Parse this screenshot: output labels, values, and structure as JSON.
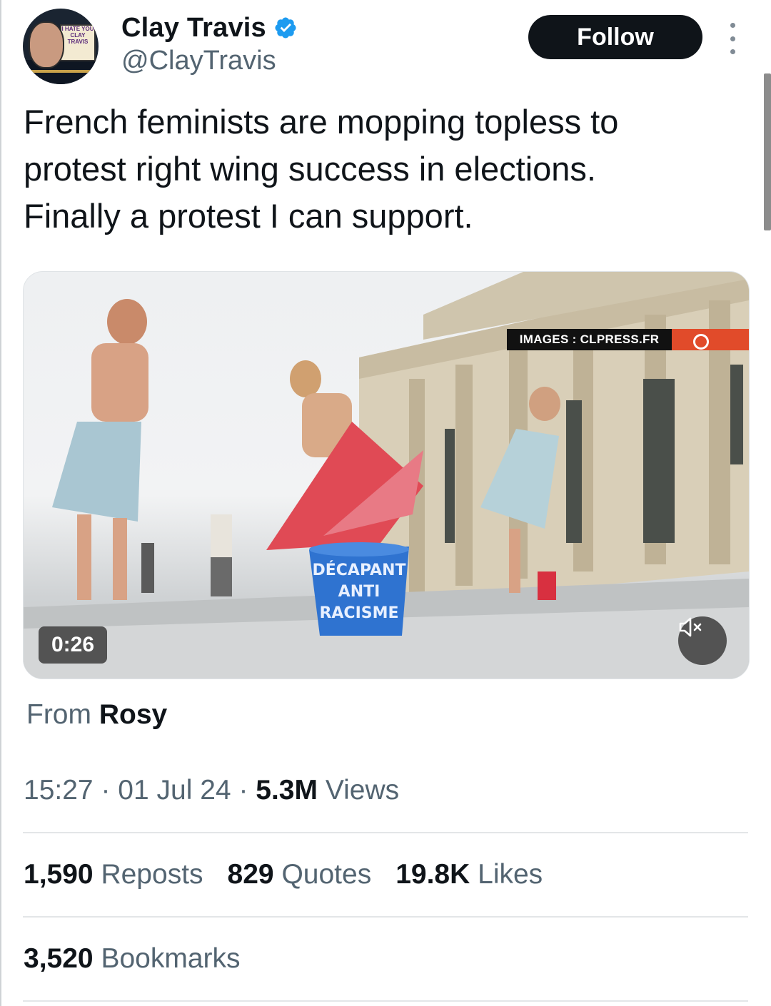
{
  "author": {
    "display_name": "Clay Travis",
    "handle": "@ClayTravis",
    "avatar_poster_text": [
      "I HATE YOU",
      "CLAY",
      "TRAVIS"
    ],
    "verified_color": "#1d9bf0"
  },
  "actions": {
    "follow_label": "Follow"
  },
  "tweet": {
    "text_lines": [
      "French feminists are mopping topless to",
      "protest right wing success in elections.",
      "Finally a protest I can support."
    ]
  },
  "video": {
    "watermark": "IMAGES : CLPRESS.FR",
    "bucket_text": [
      "DÉCAPANT",
      "ANTI",
      "RACISME"
    ],
    "duration": "0:26",
    "mute_icon": "speaker-muted-icon"
  },
  "attribution": {
    "prefix": "From",
    "source": "Rosy"
  },
  "meta": {
    "time": "15:27",
    "date": "01 Jul 24",
    "views_value": "5.3M",
    "views_label": "Views",
    "separator": "·"
  },
  "stats": {
    "reposts_value": "1,590",
    "reposts_label": "Reposts",
    "quotes_value": "829",
    "quotes_label": "Quotes",
    "likes_value": "19.8K",
    "likes_label": "Likes",
    "bookmarks_value": "3,520",
    "bookmarks_label": "Bookmarks"
  }
}
